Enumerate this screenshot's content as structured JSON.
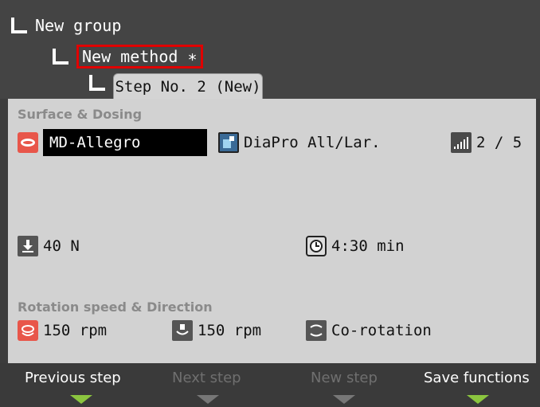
{
  "tree": {
    "group": "New group",
    "method": "New method ∗",
    "step_tab": "Step No. 2 (New)"
  },
  "surface_dosing": {
    "title": "Surface & Dosing",
    "surface": "MD-Allegro",
    "suspension": "DiaPro All/Lar.",
    "dosing_level": "2 / 5",
    "force": "40 N",
    "time": "4:30 min"
  },
  "rotation": {
    "title": "Rotation speed & Direction",
    "disc_speed": "150 rpm",
    "holder_speed": "150 rpm",
    "direction": "Co-rotation"
  },
  "softkeys": {
    "previous": "Previous step",
    "next": "Next step",
    "new": "New step",
    "save": "Save functions"
  },
  "icons": {
    "surface": "surface-disc-icon",
    "suspension": "suspension-bottle-icon",
    "dosing": "dosing-level-icon",
    "force": "force-down-icon",
    "time": "clock-icon",
    "disc_rotation": "disc-rotation-icon",
    "holder_rotation": "holder-rotation-icon",
    "direction": "rotation-direction-icon"
  },
  "colors": {
    "accent_green": "#8bc53f",
    "highlight_red": "#e00000",
    "selected_bg": "#000000"
  }
}
